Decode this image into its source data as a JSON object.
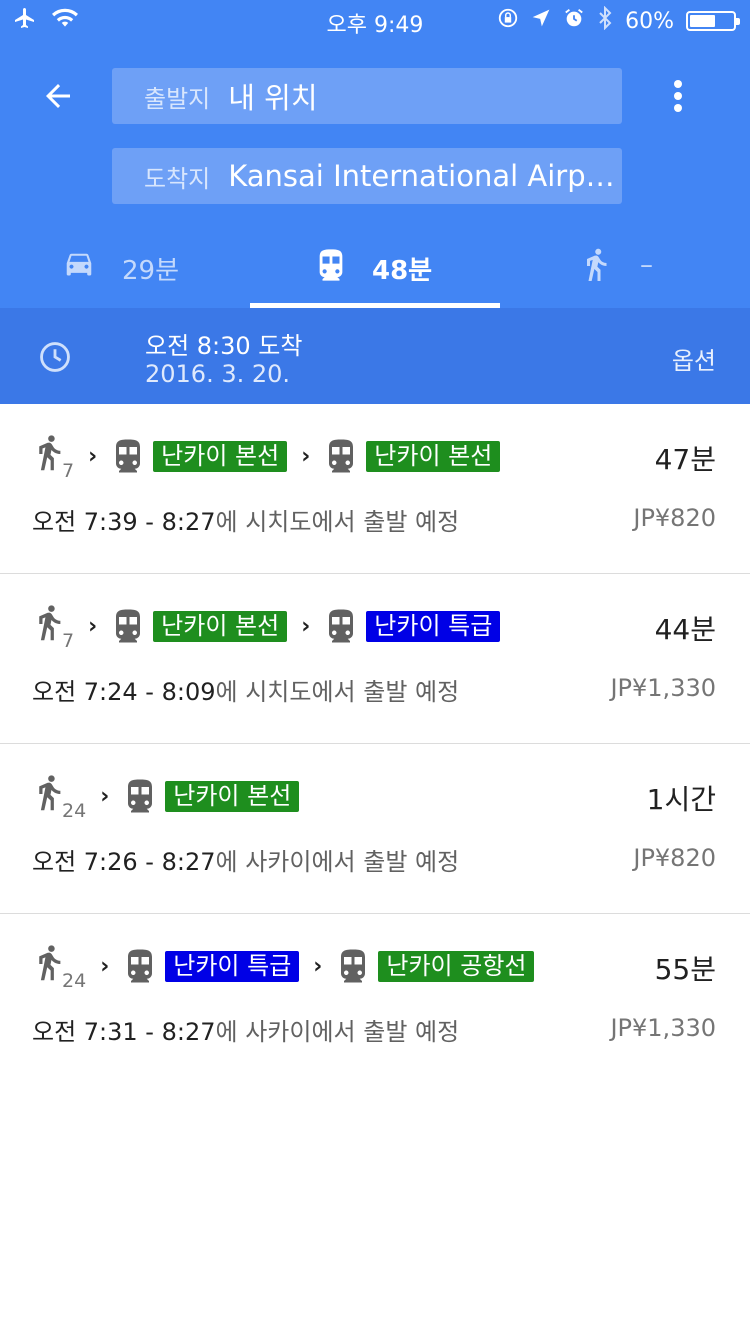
{
  "status_bar": {
    "time": "오후 9:49",
    "battery": "60%",
    "battery_level": 0.6
  },
  "search": {
    "origin_label": "출발지",
    "origin_value": "내 위치",
    "destination_label": "도착지",
    "destination_value": "Kansai International Airport"
  },
  "modes": [
    {
      "name": "drive",
      "icon": "car-icon",
      "label": "29분"
    },
    {
      "name": "transit",
      "icon": "train-icon",
      "label": "48분",
      "active": true
    },
    {
      "name": "walk",
      "icon": "walk-icon",
      "label": "–"
    }
  ],
  "time_bar": {
    "arrival": "오전 8:30 도착",
    "date": "2016. 3. 20.",
    "options": "옵션"
  },
  "colors": {
    "header": "#4285f4",
    "time_bar": "#3b78e7",
    "line_green": "#1e8e1e",
    "line_blue": "#0000e6"
  },
  "routes": [
    {
      "walk_minutes": "7",
      "lines": [
        {
          "label": "난카이 본선",
          "color": "#1e8e1e"
        },
        {
          "label": "난카이 본선",
          "color": "#1e8e1e"
        }
      ],
      "duration": "47분",
      "times": "오전 7:39 - 8:27",
      "depart_text": "에 시치도에서 출발 예정",
      "fare": "JP¥820"
    },
    {
      "walk_minutes": "7",
      "lines": [
        {
          "label": "난카이 본선",
          "color": "#1e8e1e"
        },
        {
          "label": "난카이 특급",
          "color": "#0000e6"
        }
      ],
      "duration": "44분",
      "times": "오전 7:24 - 8:09",
      "depart_text": "에 시치도에서 출발 예정",
      "fare": "JP¥1,330"
    },
    {
      "walk_minutes": "24",
      "lines": [
        {
          "label": "난카이 본선",
          "color": "#1e8e1e"
        }
      ],
      "duration": "1시간",
      "times": "오전 7:26 - 8:27",
      "depart_text": "에 사카이에서 출발 예정",
      "fare": "JP¥820"
    },
    {
      "walk_minutes": "24",
      "lines": [
        {
          "label": "난카이 특급",
          "color": "#0000e6"
        },
        {
          "label": "난카이 공항선",
          "color": "#1e8e1e"
        }
      ],
      "duration": "55분",
      "times": "오전 7:31 - 8:27",
      "depart_text": "에 사카이에서 출발 예정",
      "fare": "JP¥1,330"
    }
  ]
}
